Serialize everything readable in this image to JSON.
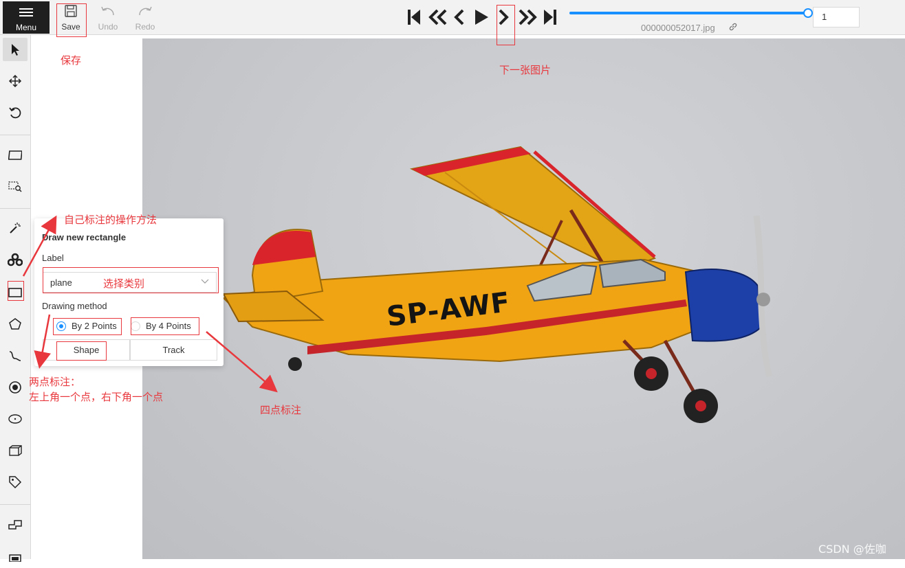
{
  "topbar": {
    "menu_label": "Menu",
    "save_label": "Save",
    "undo_label": "Undo",
    "redo_label": "Redo",
    "frame_number": "1",
    "filename": "000000052017.jpg",
    "frame_progress": 1.0
  },
  "popover": {
    "title": "Draw new rectangle",
    "label_caption": "Label",
    "label_value": "plane",
    "method_caption": "Drawing method",
    "method_options": [
      "By 2 Points",
      "By 4 Points"
    ],
    "selected_method": "By 2 Points",
    "shape_button": "Shape",
    "track_button": "Track"
  },
  "annotations": {
    "save_note": "保存",
    "next_note": "下一张图片",
    "manual_note": "自己标注的操作方法",
    "select_class_note": "选择类别",
    "two_point_note_line1": "两点标注：",
    "two_point_note_line2": "左上角一个点，右下角一个点",
    "four_point_note": "四点标注"
  },
  "canvas": {
    "aircraft_registration": "SP-AWF"
  },
  "watermark": "CSDN @佐咖",
  "colors": {
    "accent": "#1890ff",
    "annotation_red": "#e8383d",
    "toolbar_bg": "#f2f2f2",
    "menu_bg": "#1f1f1f"
  },
  "icons": {
    "sidebar": [
      "cursor-icon",
      "move-icon",
      "rotate-icon",
      "fit-image-icon",
      "zoom-region-icon",
      "magic-wand-icon",
      "opencv-icon",
      "rectangle-icon",
      "polygon-icon",
      "polyline-icon",
      "points-icon",
      "ellipse-icon",
      "cuboid-icon",
      "tag-icon",
      "merge-icon",
      "group-icon"
    ]
  }
}
